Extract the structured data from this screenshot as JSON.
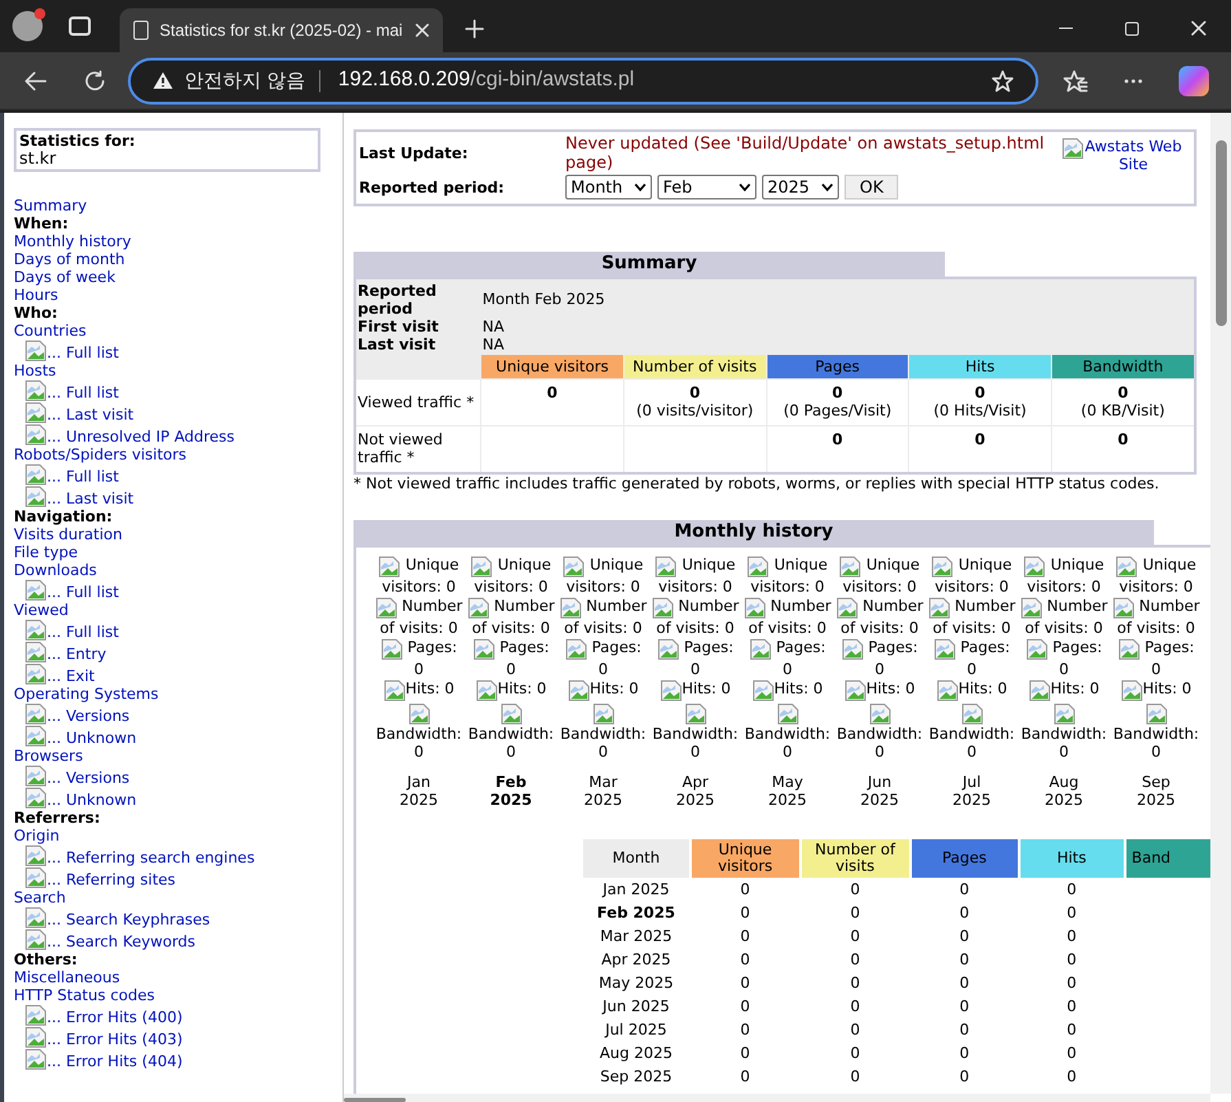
{
  "browser": {
    "tab_title": "Statistics for st.kr (2025-02) - mai",
    "security_label": "안전하지 않음",
    "url_host": "192.168.0.209",
    "url_path": "/cgi-bin/awstats.pl"
  },
  "sidebar": {
    "header_label": "Statistics for:",
    "site": "st.kr",
    "items": [
      {
        "kind": "link",
        "label": "Summary"
      },
      {
        "kind": "heading",
        "label": "When:"
      },
      {
        "kind": "link",
        "label": "Monthly history"
      },
      {
        "kind": "link",
        "label": "Days of month"
      },
      {
        "kind": "link",
        "label": "Days of week"
      },
      {
        "kind": "link",
        "label": "Hours"
      },
      {
        "kind": "heading",
        "label": "Who:"
      },
      {
        "kind": "link",
        "label": "Countries"
      },
      {
        "kind": "sublink",
        "label": "... Full list"
      },
      {
        "kind": "link",
        "label": "Hosts"
      },
      {
        "kind": "sublink",
        "label": "... Full list"
      },
      {
        "kind": "sublink",
        "label": "... Last visit"
      },
      {
        "kind": "sublink",
        "label": "... Unresolved IP Address"
      },
      {
        "kind": "link",
        "label": "Robots/Spiders visitors"
      },
      {
        "kind": "sublink",
        "label": "... Full list"
      },
      {
        "kind": "sublink",
        "label": "... Last visit"
      },
      {
        "kind": "heading",
        "label": "Navigation:"
      },
      {
        "kind": "link",
        "label": "Visits duration"
      },
      {
        "kind": "link",
        "label": "File type"
      },
      {
        "kind": "link",
        "label": "Downloads"
      },
      {
        "kind": "sublink",
        "label": "... Full list"
      },
      {
        "kind": "link",
        "label": "Viewed"
      },
      {
        "kind": "sublink",
        "label": "... Full list"
      },
      {
        "kind": "sublink",
        "label": "... Entry"
      },
      {
        "kind": "sublink",
        "label": "... Exit"
      },
      {
        "kind": "link",
        "label": "Operating Systems"
      },
      {
        "kind": "sublink",
        "label": "... Versions"
      },
      {
        "kind": "sublink",
        "label": "... Unknown"
      },
      {
        "kind": "link",
        "label": "Browsers"
      },
      {
        "kind": "sublink",
        "label": "... Versions"
      },
      {
        "kind": "sublink",
        "label": "... Unknown"
      },
      {
        "kind": "heading",
        "label": "Referrers:"
      },
      {
        "kind": "link",
        "label": "Origin"
      },
      {
        "kind": "sublink",
        "label": "... Referring search engines"
      },
      {
        "kind": "sublink",
        "label": "... Referring sites"
      },
      {
        "kind": "link",
        "label": "Search"
      },
      {
        "kind": "sublink",
        "label": "... Search Keyphrases"
      },
      {
        "kind": "sublink",
        "label": "... Search Keywords"
      },
      {
        "kind": "heading",
        "label": "Others:"
      },
      {
        "kind": "link",
        "label": "Miscellaneous"
      },
      {
        "kind": "link",
        "label": "HTTP Status codes"
      },
      {
        "kind": "sublink",
        "label": "... Error Hits (400)"
      },
      {
        "kind": "sublink",
        "label": "... Error Hits (403)"
      },
      {
        "kind": "sublink",
        "label": "... Error Hits (404)"
      }
    ]
  },
  "update_panel": {
    "last_update_label": "Last Update:",
    "last_update_value": "Never updated (See 'Build/Update' on awstats_setup.html page)",
    "period_label": "Reported period:",
    "selects": [
      {
        "value": "Month"
      },
      {
        "value": "Feb"
      },
      {
        "value": "2025"
      }
    ],
    "ok_button": "OK",
    "site_link": "Awstats Web Site"
  },
  "summary": {
    "title": "Summary",
    "info": [
      {
        "label": "Reported period",
        "value": "Month Feb 2025"
      },
      {
        "label": "First visit",
        "value": "NA"
      },
      {
        "label": "Last visit",
        "value": "NA"
      }
    ],
    "columns": [
      {
        "label": "Unique visitors",
        "color": "#f9a764"
      },
      {
        "label": "Number of visits",
        "color": "#f3ef8f"
      },
      {
        "label": "Pages",
        "color": "#4477dd"
      },
      {
        "label": "Hits",
        "color": "#66ddee"
      },
      {
        "label": "Bandwidth",
        "color": "#2ea495"
      }
    ],
    "rows": [
      {
        "label": "Viewed traffic *",
        "cells": [
          {
            "value": "0"
          },
          {
            "value": "0",
            "note": "(0 visits/visitor)"
          },
          {
            "value": "0",
            "note": "(0 Pages/Visit)"
          },
          {
            "value": "0",
            "note": "(0 Hits/Visit)"
          },
          {
            "value": "0",
            "note": "(0 KB/Visit)"
          }
        ]
      },
      {
        "label": "Not viewed traffic *",
        "cells": [
          {},
          {},
          {
            "value": "0"
          },
          {
            "value": "0"
          },
          {
            "value": "0"
          }
        ]
      }
    ],
    "footnote": "* Not viewed traffic includes traffic generated by robots, worms, or replies with special HTTP status codes."
  },
  "monthly": {
    "title": "Monthly history",
    "months": [
      {
        "label": "Jan",
        "year": "2025",
        "selected": false,
        "stats": [
          "Unique visitors: 0",
          "Number of visits: 0",
          "Pages: 0",
          "Hits: 0",
          "Bandwidth: 0"
        ]
      },
      {
        "label": "Feb",
        "year": "2025",
        "selected": true,
        "stats": [
          "Unique visitors: 0",
          "Number of visits: 0",
          "Pages: 0",
          "Hits: 0",
          "Bandwidth: 0"
        ]
      },
      {
        "label": "Mar",
        "year": "2025",
        "selected": false,
        "stats": [
          "Unique visitors: 0",
          "Number of visits: 0",
          "Pages: 0",
          "Hits: 0",
          "Bandwidth: 0"
        ]
      },
      {
        "label": "Apr",
        "year": "2025",
        "selected": false,
        "stats": [
          "Unique visitors: 0",
          "Number of visits: 0",
          "Pages: 0",
          "Hits: 0",
          "Bandwidth: 0"
        ]
      },
      {
        "label": "May",
        "year": "2025",
        "selected": false,
        "stats": [
          "Unique visitors: 0",
          "Number of visits: 0",
          "Pages: 0",
          "Hits: 0",
          "Bandwidth: 0"
        ]
      },
      {
        "label": "Jun",
        "year": "2025",
        "selected": false,
        "stats": [
          "Unique visitors: 0",
          "Number of visits: 0",
          "Pages: 0",
          "Hits: 0",
          "Bandwidth: 0"
        ]
      },
      {
        "label": "Jul",
        "year": "2025",
        "selected": false,
        "stats": [
          "Unique visitors: 0",
          "Number of visits: 0",
          "Pages: 0",
          "Hits: 0",
          "Bandwidth: 0"
        ]
      },
      {
        "label": "Aug",
        "year": "2025",
        "selected": false,
        "stats": [
          "Unique visitors: 0",
          "Number of visits: 0",
          "Pages: 0",
          "Hits: 0",
          "Bandwidth: 0"
        ]
      },
      {
        "label": "Sep",
        "year": "2025",
        "selected": false,
        "stats": [
          "Unique visitors: 0",
          "Number of visits: 0",
          "Pages: 0",
          "Hits: 0",
          "Bandwidth: 0"
        ]
      }
    ],
    "table": {
      "columns": [
        {
          "label": "Month",
          "color": "#ececec"
        },
        {
          "label": "Unique visitors",
          "color": "#f9a764"
        },
        {
          "label": "Number of visits",
          "color": "#f3ef8f"
        },
        {
          "label": "Pages",
          "color": "#4477dd"
        },
        {
          "label": "Hits",
          "color": "#66ddee"
        },
        {
          "label": "Band",
          "color": "#2ea495"
        }
      ],
      "rows": [
        {
          "month": "Jan 2025",
          "selected": false,
          "values": [
            "0",
            "0",
            "0",
            "0"
          ]
        },
        {
          "month": "Feb 2025",
          "selected": true,
          "values": [
            "0",
            "0",
            "0",
            "0"
          ]
        },
        {
          "month": "Mar 2025",
          "selected": false,
          "values": [
            "0",
            "0",
            "0",
            "0"
          ]
        },
        {
          "month": "Apr 2025",
          "selected": false,
          "values": [
            "0",
            "0",
            "0",
            "0"
          ]
        },
        {
          "month": "May 2025",
          "selected": false,
          "values": [
            "0",
            "0",
            "0",
            "0"
          ]
        },
        {
          "month": "Jun 2025",
          "selected": false,
          "values": [
            "0",
            "0",
            "0",
            "0"
          ]
        },
        {
          "month": "Jul 2025",
          "selected": false,
          "values": [
            "0",
            "0",
            "0",
            "0"
          ]
        },
        {
          "month": "Aug 2025",
          "selected": false,
          "values": [
            "0",
            "0",
            "0",
            "0"
          ]
        },
        {
          "month": "Sep 2025",
          "selected": false,
          "values": [
            "0",
            "0",
            "0",
            "0"
          ]
        }
      ]
    }
  }
}
